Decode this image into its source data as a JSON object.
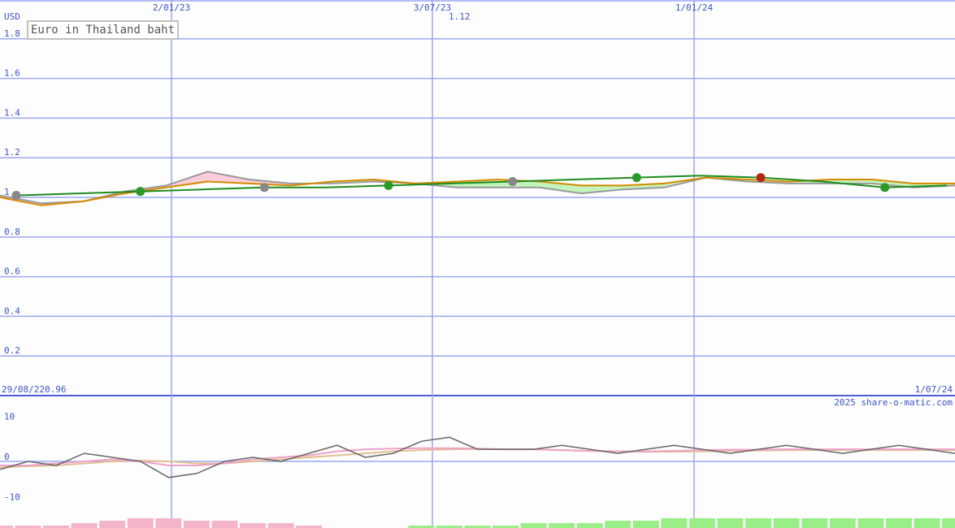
{
  "chart_data": [
    {
      "type": "line",
      "title": "Euro in Thailand baht",
      "ylabel": "USD",
      "ylim": [
        0,
        1.9
      ],
      "yticks": [
        "1.8",
        "1.6",
        "1.4",
        "1.2",
        "1",
        "0.8",
        "0.6",
        "0.4",
        "0.2"
      ],
      "xticks": [
        "2/01/23",
        "3/07/23",
        "1/01/24"
      ],
      "start_date": "29/08/22",
      "start_value": "0.96",
      "end_date": "1/07/24",
      "peak_value": "1.12",
      "grid": true,
      "x": [
        "2022-08",
        "2022-09",
        "2022-10",
        "2022-11",
        "2022-12",
        "2023-01",
        "2023-02",
        "2023-03",
        "2023-04",
        "2023-05",
        "2023-06",
        "2023-07",
        "2023-08",
        "2023-09",
        "2023-10",
        "2023-11",
        "2023-12",
        "2024-01",
        "2024-02",
        "2024-03",
        "2024-04",
        "2024-05",
        "2024-06",
        "2024-07"
      ],
      "series": [
        {
          "values": [
            1.01,
            0.97,
            0.98,
            1.03,
            1.06,
            1.13,
            1.09,
            1.07,
            1.07,
            1.08,
            1.07,
            1.05,
            1.05,
            1.05,
            1.02,
            1.04,
            1.05,
            1.1,
            1.08,
            1.07,
            1.07,
            1.07,
            1.05,
            1.06
          ],
          "color": "#999999"
        },
        {
          "values": [
            1.0,
            0.96,
            0.98,
            1.02,
            1.05,
            1.08,
            1.07,
            1.06,
            1.08,
            1.09,
            1.07,
            1.08,
            1.09,
            1.08,
            1.06,
            1.06,
            1.07,
            1.1,
            1.09,
            1.08,
            1.09,
            1.09,
            1.07,
            1.07
          ],
          "color": "#d48a00"
        },
        {
          "values": [
            1.01,
            1.02,
            1.03,
            1.04,
            1.05,
            1.05,
            1.06,
            1.07,
            1.08,
            1.09,
            1.1,
            1.11,
            1.1,
            1.08,
            1.05,
            1.06
          ],
          "color": "#1e8c1e"
        }
      ]
    },
    {
      "type": "line",
      "ylim": [
        -10,
        10
      ],
      "yticks": [
        "10",
        "0",
        "-10"
      ],
      "watermark": "2025 share-o-matic.com",
      "series": [
        {
          "values": [
            -2,
            0,
            -1,
            2,
            1,
            0,
            -4,
            -3,
            0,
            1,
            0,
            2,
            4,
            1,
            2,
            5,
            6,
            3,
            3,
            3,
            4,
            3,
            2,
            3,
            4,
            3,
            2,
            3,
            4,
            3,
            2,
            3,
            4,
            3,
            2
          ],
          "color": "#666666"
        },
        {
          "values": [
            -1,
            -1,
            -0.5,
            0,
            0.5,
            0,
            -1,
            -1,
            -0.5,
            0.5,
            1,
            1.5,
            2.5,
            3,
            3.2,
            3.3,
            3.3,
            3.2,
            3,
            3,
            2.8,
            2.6,
            2.5,
            2.5,
            2.6,
            2.8,
            2.9,
            2.9,
            3,
            3,
            3,
            3,
            3,
            3,
            3
          ],
          "color": "#f0a0c8"
        },
        {
          "values": [
            -1.5,
            -1.2,
            -1,
            -0.5,
            0,
            0.2,
            0,
            -0.5,
            -0.5,
            0,
            0.5,
            1,
            1.5,
            2,
            2.5,
            2.8,
            3,
            3.1,
            3,
            3,
            2.8,
            2.6,
            2.5,
            2.4,
            2.4,
            2.5,
            2.6,
            2.7,
            2.8,
            2.8,
            2.8,
            2.8,
            2.8,
            2.8,
            2.8
          ],
          "color": "#e0c090"
        },
        {
          "values": [
            -1,
            -1,
            -1,
            -2,
            -3,
            -4,
            -4,
            -3,
            -3,
            -2,
            -2,
            -1,
            0,
            0,
            0,
            1,
            1,
            1,
            1,
            2,
            2,
            2,
            3,
            3,
            4,
            4,
            4,
            4,
            4,
            4,
            4,
            4,
            4,
            4,
            4
          ],
          "color": "#f5b5c8",
          "positive_color": "#99ee88"
        }
      ]
    }
  ]
}
